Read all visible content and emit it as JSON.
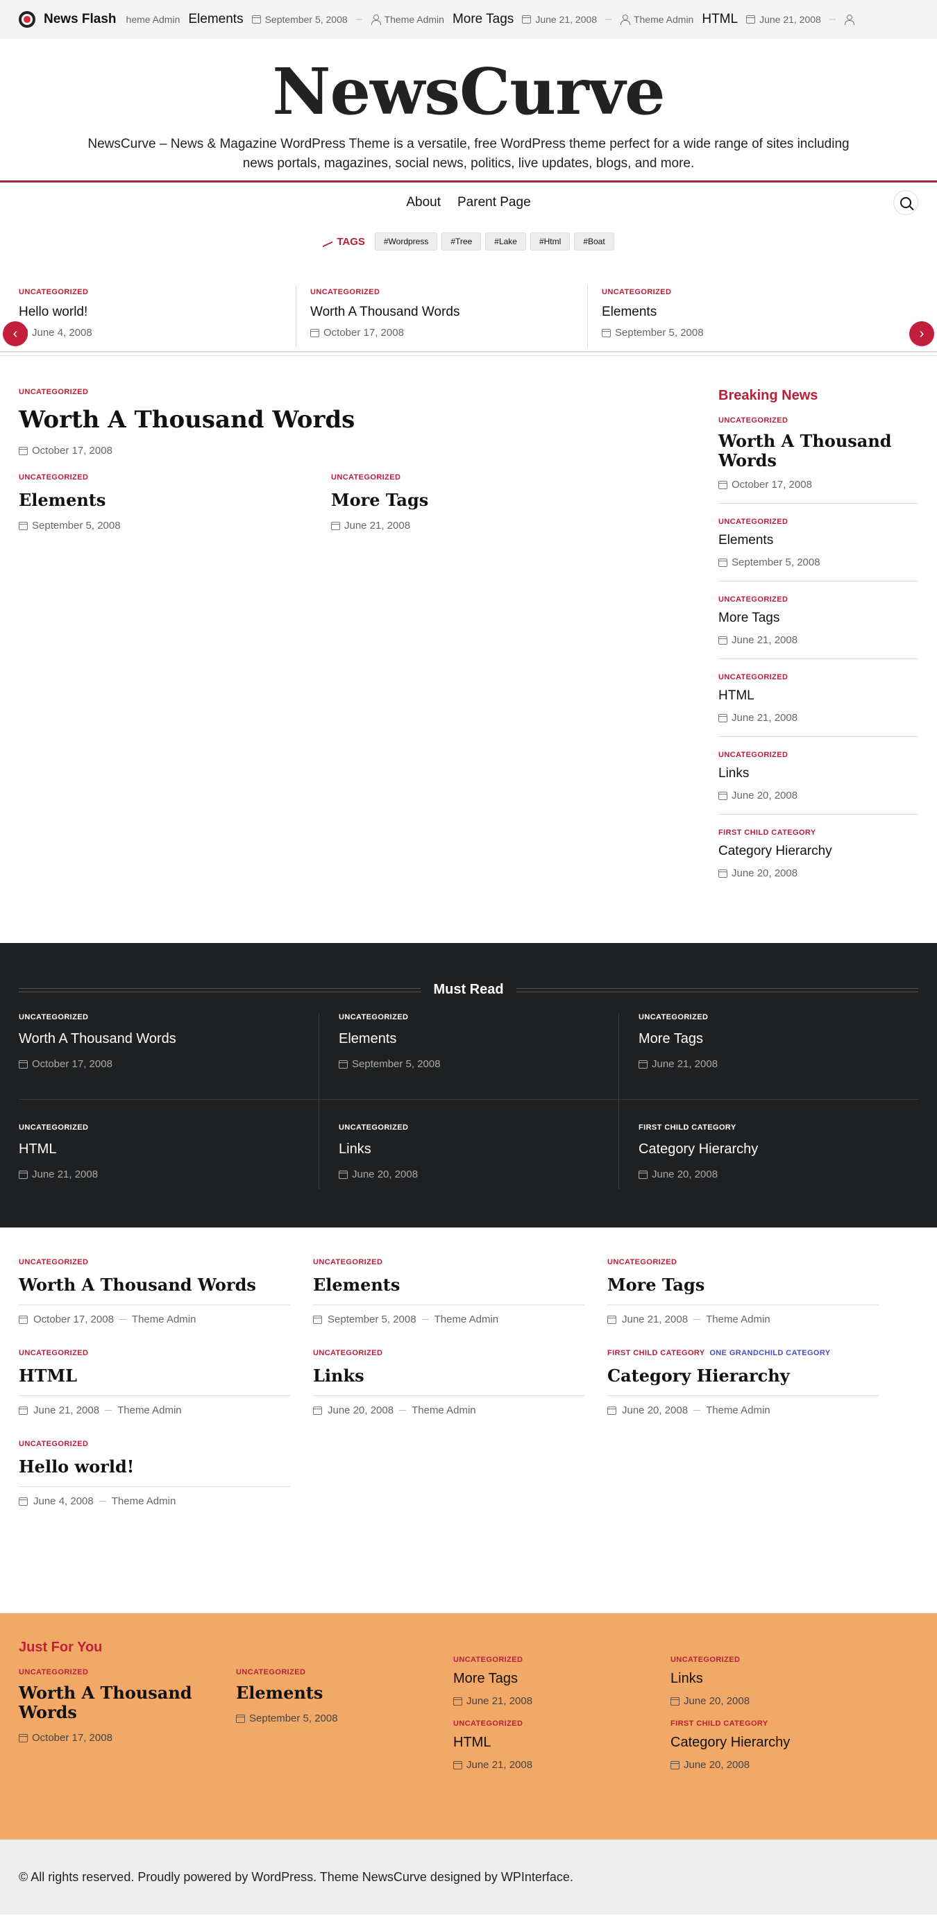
{
  "topbar": {
    "brand": "News Flash",
    "ticker": [
      {
        "title": "",
        "meta": "heme Admin",
        "kind": "author"
      },
      {
        "title": "Elements",
        "date": "September 5, 2008",
        "author": "Theme Admin"
      },
      {
        "title": "More Tags",
        "date": "June 21, 2008",
        "author": "Theme Admin"
      },
      {
        "title": "HTML",
        "date": "June 21, 2008"
      }
    ]
  },
  "header": {
    "site_title": "NewsCurve",
    "tagline": "NewsCurve – News & Magazine WordPress Theme is a versatile, free WordPress theme perfect for a wide range of sites including news portals, magazines, social news, politics, live updates, blogs, and more."
  },
  "nav": {
    "items": [
      "About",
      "Parent Page"
    ]
  },
  "tags": {
    "label": "TAGS",
    "items": [
      "#Wordpress",
      "#Tree",
      "#Lake",
      "#Html",
      "#Boat"
    ]
  },
  "slider": [
    {
      "cat": "UNCATEGORIZED",
      "title": "Hello world!",
      "date": "June 4, 2008"
    },
    {
      "cat": "UNCATEGORIZED",
      "title": "Worth A Thousand Words",
      "date": "October 17, 2008"
    },
    {
      "cat": "UNCATEGORIZED",
      "title": "Elements",
      "date": "September 5, 2008"
    }
  ],
  "featured": {
    "main": {
      "cat": "UNCATEGORIZED",
      "title": "Worth A Thousand Words",
      "date": "October 17, 2008"
    },
    "subs": [
      {
        "cat": "UNCATEGORIZED",
        "title": "Elements",
        "date": "September 5, 2008"
      },
      {
        "cat": "UNCATEGORIZED",
        "title": "More Tags",
        "date": "June 21, 2008"
      }
    ]
  },
  "breaking": {
    "heading": "Breaking News",
    "items": [
      {
        "cat": "UNCATEGORIZED",
        "title": "Worth A Thousand Words",
        "date": "October 17, 2008"
      },
      {
        "cat": "UNCATEGORIZED",
        "title": "Elements",
        "date": "September 5, 2008"
      },
      {
        "cat": "UNCATEGORIZED",
        "title": "More Tags",
        "date": "June 21, 2008"
      },
      {
        "cat": "UNCATEGORIZED",
        "title": "HTML",
        "date": "June 21, 2008"
      },
      {
        "cat": "UNCATEGORIZED",
        "title": "Links",
        "date": "June 20, 2008"
      },
      {
        "cat": "FIRST CHILD CATEGORY",
        "title": "Category Hierarchy",
        "date": "June 20, 2008"
      }
    ]
  },
  "mustread": {
    "heading": "Must Read",
    "items": [
      {
        "cat": "UNCATEGORIZED",
        "title": "Worth A Thousand Words",
        "date": "October 17, 2008"
      },
      {
        "cat": "UNCATEGORIZED",
        "title": "Elements",
        "date": "September 5, 2008"
      },
      {
        "cat": "UNCATEGORIZED",
        "title": "More Tags",
        "date": "June 21, 2008"
      },
      {
        "cat": "UNCATEGORIZED",
        "title": "HTML",
        "date": "June 21, 2008"
      },
      {
        "cat": "UNCATEGORIZED",
        "title": "Links",
        "date": "June 20, 2008"
      },
      {
        "cat": "FIRST CHILD CATEGORY",
        "title": "Category Hierarchy",
        "date": "June 20, 2008"
      }
    ]
  },
  "posts": {
    "author": "Theme Admin",
    "items": [
      {
        "cat": "UNCATEGORIZED",
        "cat2": "",
        "title": "Worth A Thousand Words",
        "date": "October 17, 2008"
      },
      {
        "cat": "UNCATEGORIZED",
        "cat2": "",
        "title": "Elements",
        "date": "September 5, 2008"
      },
      {
        "cat": "UNCATEGORIZED",
        "cat2": "",
        "title": "More Tags",
        "date": "June 21, 2008"
      },
      {
        "cat": "UNCATEGORIZED",
        "cat2": "",
        "title": "HTML",
        "date": "June 21, 2008"
      },
      {
        "cat": "UNCATEGORIZED",
        "cat2": "",
        "title": "Links",
        "date": "June 20, 2008"
      },
      {
        "cat": "FIRST CHILD CATEGORY",
        "cat2": "ONE GRANDCHILD CATEGORY",
        "title": "Category Hierarchy",
        "date": "June 20, 2008"
      },
      {
        "cat": "UNCATEGORIZED",
        "cat2": "",
        "title": "Hello world!",
        "date": "June 4, 2008"
      }
    ]
  },
  "jfy": {
    "heading": "Just For You",
    "big": [
      {
        "cat": "UNCATEGORIZED",
        "title": "Worth A Thousand Words",
        "date": "October 17, 2008"
      },
      {
        "cat": "UNCATEGORIZED",
        "title": "Elements",
        "date": "September 5, 2008"
      }
    ],
    "small": [
      {
        "cat": "UNCATEGORIZED",
        "title": "More Tags",
        "date": "June 21, 2008"
      },
      {
        "cat": "UNCATEGORIZED",
        "title": "HTML",
        "date": "June 21, 2008"
      },
      {
        "cat": "UNCATEGORIZED",
        "title": "Links",
        "date": "June 20, 2008"
      },
      {
        "cat": "FIRST CHILD CATEGORY",
        "title": "Category Hierarchy",
        "date": "June 20, 2008"
      }
    ]
  },
  "footer": {
    "text": "© All rights reserved. Proudly powered by WordPress. Theme NewsCurve designed by WPInterface."
  },
  "colors": {
    "accent": "#b8203a",
    "dark_section": "#1f2022",
    "orange_section": "#f2a867"
  }
}
